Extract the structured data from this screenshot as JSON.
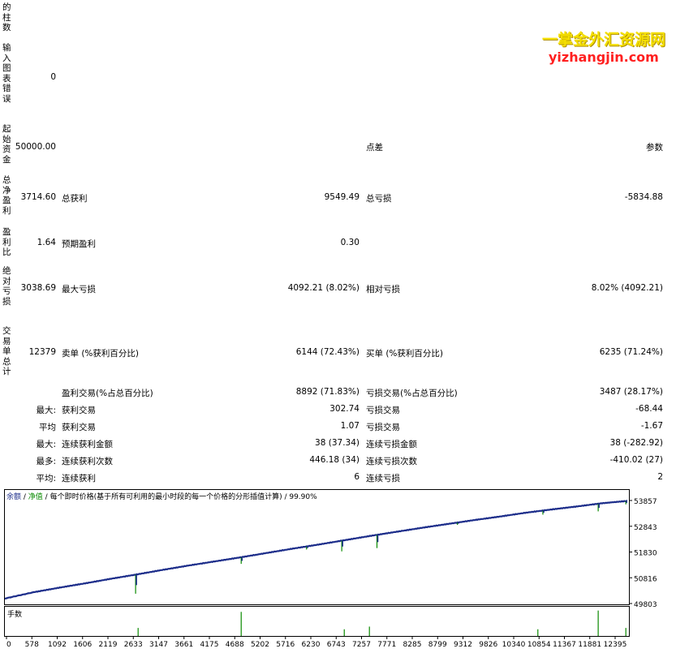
{
  "labels": {
    "a": "的柱数",
    "b": "输入图表错误",
    "c": "起始资金",
    "d": "总净盈利",
    "e": "盈利比",
    "f": "绝对亏损",
    "g": "交易单总计"
  },
  "vals": {
    "bars_input_err": "0",
    "initial_deposit": "50000.00",
    "net_profit": "3714.60",
    "profit_factor": "1.64",
    "abs_drawdown": "3038.69",
    "total_trades": "12379"
  },
  "stats": {
    "spread": "点差",
    "params": "参数",
    "gross_profit_label": "总获利",
    "gross_profit": "9549.49",
    "gross_loss_label": "总亏损",
    "gross_loss": "-5834.88",
    "expected_payoff_label": "预期盈利",
    "expected_payoff": "0.30",
    "max_dd_label": "最大亏损",
    "max_dd": "4092.21 (8.02%)",
    "rel_dd_label": "相对亏损",
    "rel_dd": "8.02% (4092.21)",
    "short_label": "卖单 (%获利百分比)",
    "short": "6144 (72.43%)",
    "long_label": "买单 (%获利百分比)",
    "long": "6235 (71.24%)",
    "win_label": "盈利交易(%占总百分比)",
    "win": "8892 (71.83%)",
    "loss_label": "亏损交易(%占总百分比)",
    "loss": "3487 (28.17%)",
    "max_prefix": "最大:",
    "avg_prefix": "平均",
    "most_prefix": "最多:",
    "avg2_prefix": "平均:",
    "largest_win_label": "获利交易",
    "largest_win": "302.74",
    "largest_loss_label": "亏损交易",
    "largest_loss": "-68.44",
    "avg_win_label": "获利交易",
    "avg_win": "1.07",
    "avg_loss_label": "亏损交易",
    "avg_loss": "-1.67",
    "max_cons_win_label": "连续获利金额",
    "max_cons_win": "38 (37.34)",
    "max_cons_loss_label": "连续亏损金额",
    "max_cons_loss": "38 (-282.92)",
    "most_cons_win_label": "连续获利次数",
    "most_cons_win": "446.18 (34)",
    "most_cons_loss_label": "连续亏损次数",
    "most_cons_loss": "-410.02 (27)",
    "avg_cons_win_label": "连续获利",
    "avg_cons_win": "6",
    "avg_cons_loss_label": "连续亏损",
    "avg_cons_loss": "2"
  },
  "watermark": {
    "line1": "一掌金外汇资源网",
    "line2": "yizhangjin.com"
  },
  "chart_legend": {
    "balance": "余额",
    "sep1": " / ",
    "equity": "净值",
    "sep2": " / ",
    "rest": "每个即时价格(基于所有可利用的最小时段的每一个价格的分形插值计算) / 99.90%"
  },
  "chart_data": {
    "type": "line",
    "y_ticks": [
      "53857",
      "52843",
      "51830",
      "50816",
      "49803"
    ],
    "y_tick_values": [
      53857,
      52843,
      51830,
      50816,
      49803
    ],
    "ylim": [
      49803,
      53857
    ],
    "x_ticks": [
      "0",
      "578",
      "1092",
      "1606",
      "2119",
      "2633",
      "3147",
      "3661",
      "4175",
      "4688",
      "5202",
      "5716",
      "6230",
      "6743",
      "7257",
      "7771",
      "8285",
      "8799",
      "9312",
      "9826",
      "10340",
      "10854",
      "11367",
      "11881",
      "12395"
    ],
    "x_tick_values": [
      0,
      578,
      1092,
      1606,
      2119,
      2633,
      3147,
      3661,
      4175,
      4688,
      5202,
      5716,
      6230,
      6743,
      7257,
      7771,
      8285,
      8799,
      9312,
      9826,
      10340,
      10854,
      11367,
      11881,
      12395
    ],
    "xlim": [
      0,
      12379
    ],
    "volume_label": "手数",
    "colors": {
      "balance": "#1c2d8a",
      "equity": "#0a8a00"
    },
    "series": [
      {
        "name": "余额",
        "x": [
          0,
          578,
          1092,
          1606,
          2119,
          2633,
          3147,
          3661,
          4175,
          4688,
          5202,
          5716,
          6230,
          6743,
          7257,
          7771,
          8285,
          8799,
          9312,
          9826,
          10340,
          10854,
          11367,
          11881,
          12379
        ],
        "values": [
          50000,
          50250,
          50430,
          50600,
          50780,
          50950,
          51130,
          51300,
          51460,
          51620,
          51790,
          51960,
          52120,
          52290,
          52460,
          52620,
          52780,
          52930,
          53080,
          53220,
          53370,
          53500,
          53620,
          53750,
          53840
        ]
      }
    ],
    "drawdowns": [
      {
        "x": 2600,
        "depth": 750
      },
      {
        "x": 4700,
        "depth": 260
      },
      {
        "x": 6000,
        "depth": 120
      },
      {
        "x": 6700,
        "depth": 420
      },
      {
        "x": 7400,
        "depth": 520
      },
      {
        "x": 9000,
        "depth": 90
      },
      {
        "x": 10700,
        "depth": 160
      },
      {
        "x": 11800,
        "depth": 300
      },
      {
        "x": 12350,
        "depth": 130
      }
    ],
    "volume_spikes": [
      {
        "x": 2650,
        "h": 0.3
      },
      {
        "x": 4700,
        "h": 0.9
      },
      {
        "x": 6750,
        "h": 0.25
      },
      {
        "x": 7250,
        "h": 0.35
      },
      {
        "x": 10600,
        "h": 0.25
      },
      {
        "x": 11800,
        "h": 0.95
      },
      {
        "x": 12350,
        "h": 0.3
      }
    ]
  }
}
